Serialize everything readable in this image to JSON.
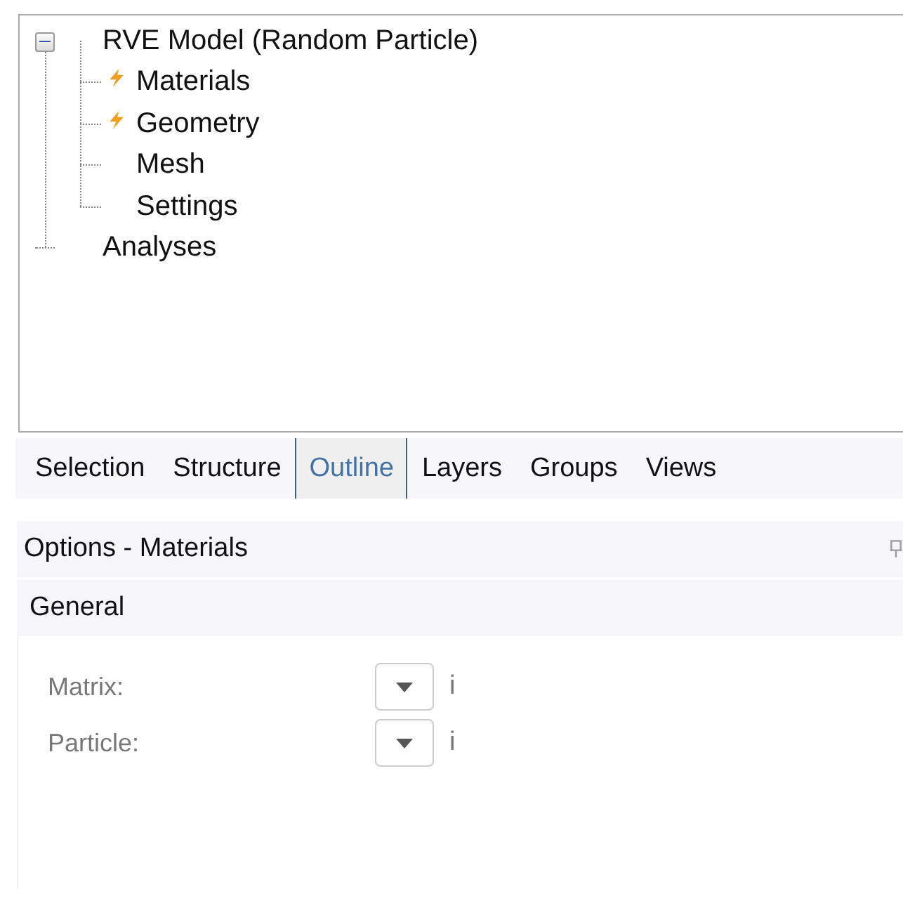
{
  "tree": [
    {
      "label": "RVE Model (Random Particle)",
      "expanded": true,
      "children": [
        {
          "label": "Materials",
          "flagged": true
        },
        {
          "label": "Geometry",
          "flagged": true
        },
        {
          "label": "Mesh",
          "flagged": false
        },
        {
          "label": "Settings",
          "flagged": false
        }
      ]
    },
    {
      "label": "Analyses"
    }
  ],
  "tabs": [
    {
      "label": "Selection",
      "selected": false
    },
    {
      "label": "Structure",
      "selected": false
    },
    {
      "label": "Outline",
      "selected": true
    },
    {
      "label": "Layers",
      "selected": false
    },
    {
      "label": "Groups",
      "selected": false
    },
    {
      "label": "Views",
      "selected": false
    }
  ],
  "options": {
    "title": "Options - Materials",
    "section": "General",
    "fields": [
      {
        "label": "Matrix:",
        "info": "i"
      },
      {
        "label": "Particle:",
        "info": "i"
      }
    ]
  }
}
